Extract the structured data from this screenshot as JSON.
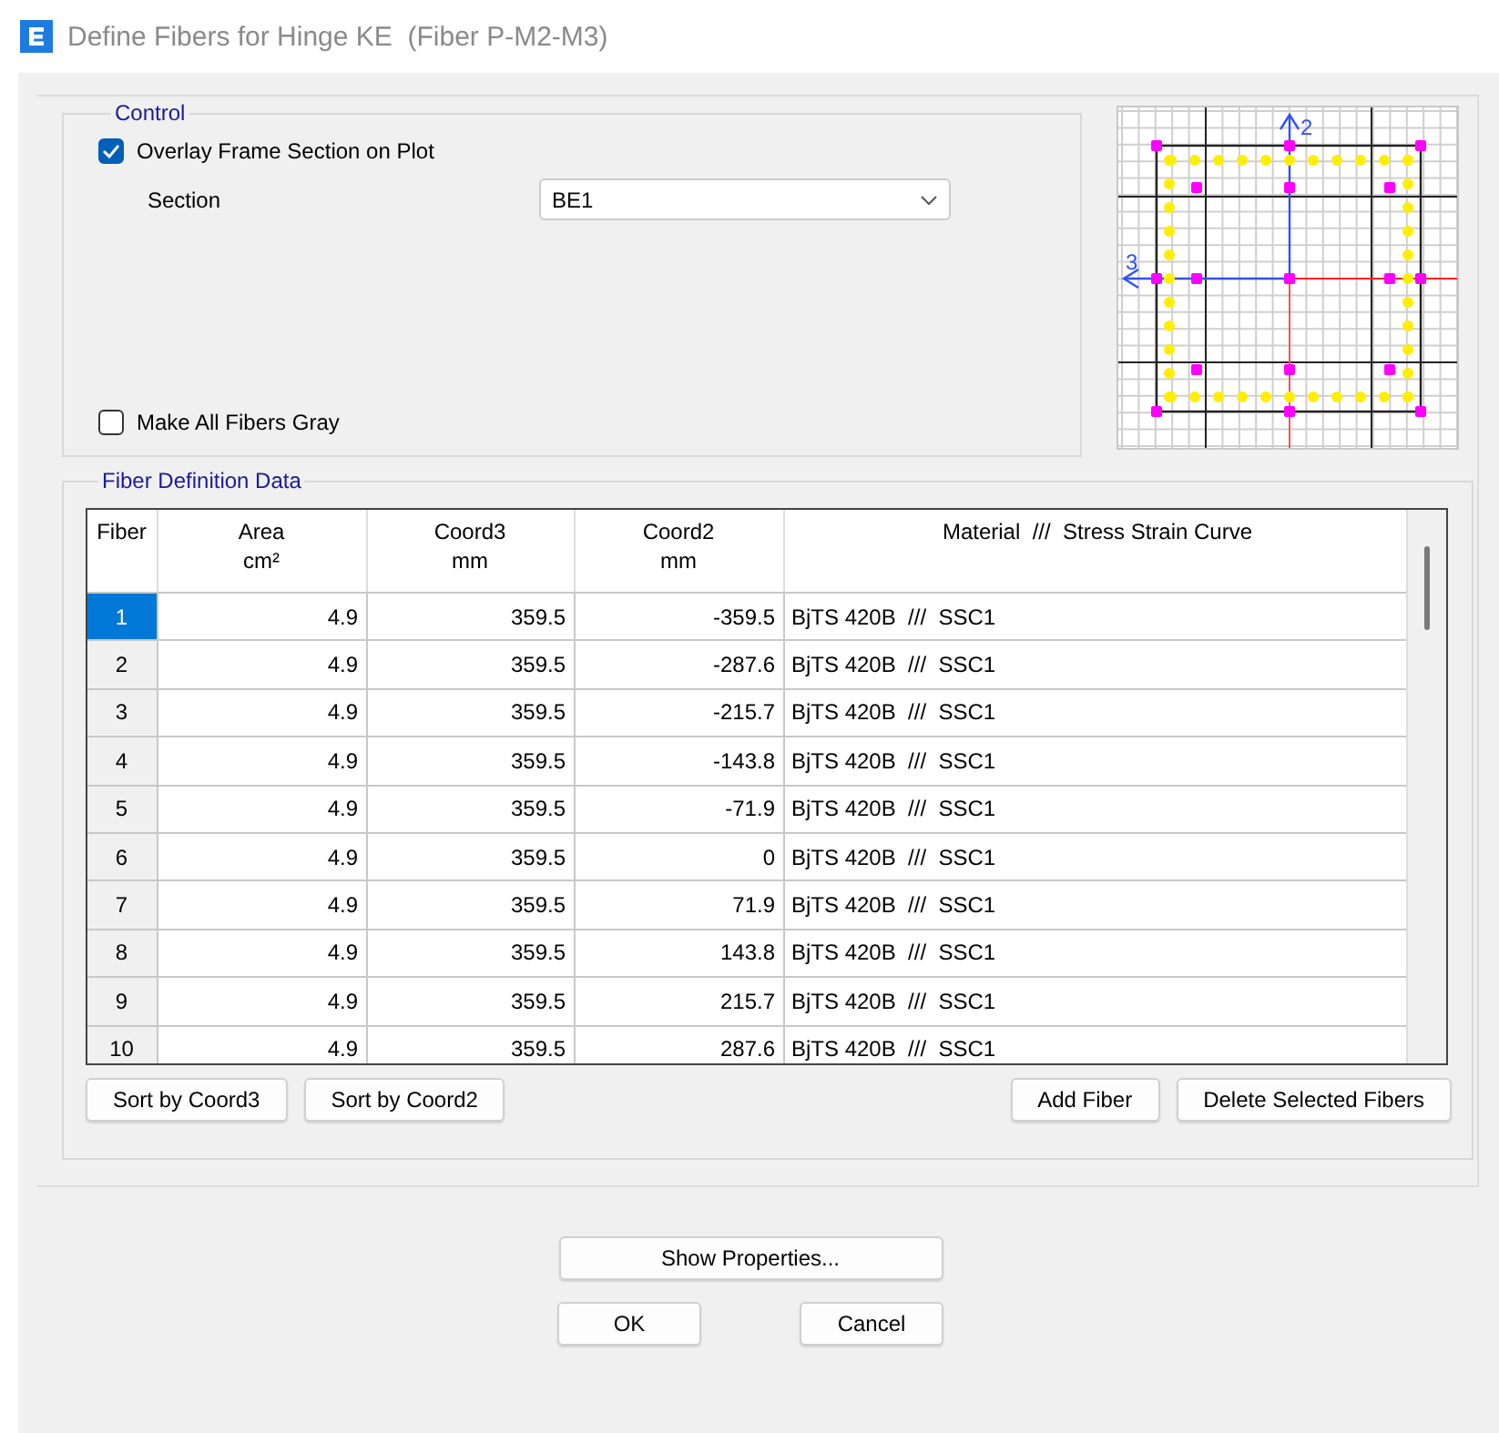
{
  "window": {
    "title": "Define Fibers for Hinge KE  (Fiber P-M2-M3)"
  },
  "control": {
    "title": "Control",
    "overlay": {
      "label": "Overlay Frame Section on Plot",
      "checked": true
    },
    "section": {
      "label": "Section",
      "value": "BE1"
    },
    "gray": {
      "label": "Make All Fibers Gray",
      "checked": false
    }
  },
  "plot": {
    "axis_labels": [
      "2",
      "3"
    ]
  },
  "fiber_data": {
    "title": "Fiber Definition Data",
    "columns": [
      {
        "label": "Fiber"
      },
      {
        "label": "Area",
        "unit": "cm²"
      },
      {
        "label": "Coord3",
        "unit": "mm"
      },
      {
        "label": "Coord2",
        "unit": "mm"
      },
      {
        "label": "Material  ///  Stress Strain Curve"
      }
    ],
    "rows": [
      {
        "fiber": "1",
        "area": "4.9",
        "coord3": "359.5",
        "coord2": "-359.5",
        "material": "BjTS 420B  ///  SSC1",
        "selected": true
      },
      {
        "fiber": "2",
        "area": "4.9",
        "coord3": "359.5",
        "coord2": "-287.6",
        "material": "BjTS 420B  ///  SSC1",
        "selected": false
      },
      {
        "fiber": "3",
        "area": "4.9",
        "coord3": "359.5",
        "coord2": "-215.7",
        "material": "BjTS 420B  ///  SSC1",
        "selected": false
      },
      {
        "fiber": "4",
        "area": "4.9",
        "coord3": "359.5",
        "coord2": "-143.8",
        "material": "BjTS 420B  ///  SSC1",
        "selected": false
      },
      {
        "fiber": "5",
        "area": "4.9",
        "coord3": "359.5",
        "coord2": "-71.9",
        "material": "BjTS 420B  ///  SSC1",
        "selected": false
      },
      {
        "fiber": "6",
        "area": "4.9",
        "coord3": "359.5",
        "coord2": "0",
        "material": "BjTS 420B  ///  SSC1",
        "selected": false
      },
      {
        "fiber": "7",
        "area": "4.9",
        "coord3": "359.5",
        "coord2": "71.9",
        "material": "BjTS 420B  ///  SSC1",
        "selected": false
      },
      {
        "fiber": "8",
        "area": "4.9",
        "coord3": "359.5",
        "coord2": "143.8",
        "material": "BjTS 420B  ///  SSC1",
        "selected": false
      },
      {
        "fiber": "9",
        "area": "4.9",
        "coord3": "359.5",
        "coord2": "215.7",
        "material": "BjTS 420B  ///  SSC1",
        "selected": false
      },
      {
        "fiber": "10",
        "area": "4.9",
        "coord3": "359.5",
        "coord2": "287.6",
        "material": "BjTS 420B  ///  SSC1",
        "selected": false
      }
    ],
    "left_buttons": [
      "Sort by Coord3",
      "Sort by Coord2"
    ],
    "right_buttons": [
      "Add Fiber",
      "Delete Selected Fibers"
    ]
  },
  "buttons": [
    "Show Properties...",
    "OK",
    "Cancel"
  ]
}
